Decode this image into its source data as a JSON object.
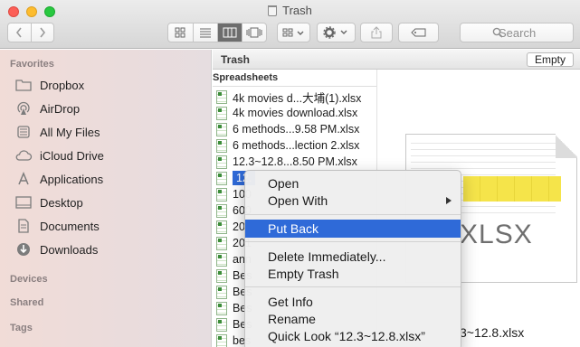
{
  "window": {
    "title": "Trash"
  },
  "toolbar": {
    "search_placeholder": "Search"
  },
  "sidebar": {
    "sections": {
      "favorites": "Favorites",
      "devices": "Devices",
      "shared": "Shared",
      "tags": "Tags"
    },
    "items": [
      {
        "label": "Dropbox",
        "icon": "folder-icon"
      },
      {
        "label": "AirDrop",
        "icon": "airdrop-icon"
      },
      {
        "label": "All My Files",
        "icon": "all-files-icon"
      },
      {
        "label": "iCloud Drive",
        "icon": "cloud-icon"
      },
      {
        "label": "Applications",
        "icon": "applications-icon"
      },
      {
        "label": "Desktop",
        "icon": "desktop-icon"
      },
      {
        "label": "Documents",
        "icon": "documents-icon"
      },
      {
        "label": "Downloads",
        "icon": "downloads-icon"
      }
    ]
  },
  "pathbar": {
    "label": "Trash",
    "empty_button": "Empty"
  },
  "filelist": {
    "column_header": "Spreadsheets",
    "files": [
      "4k movies d...大埔(1).xlsx",
      "4k movies download.xlsx",
      "6 methods...9.58 PM.xlsx",
      "6 methods...lection 2.xlsx",
      "12.3~12.8...8.50 PM.xlsx",
      "12.",
      "100",
      "600",
      "201",
      "201",
      "ann",
      "Bes",
      "Bes",
      "Bes",
      "Bes",
      "bes"
    ],
    "selected_index": 5
  },
  "preview": {
    "type_label": "XLSX",
    "filename": "3~12.8.xlsx"
  },
  "context_menu": {
    "open": "Open",
    "open_with": "Open With",
    "put_back": "Put Back",
    "delete_immediately": "Delete Immediately...",
    "empty_trash": "Empty Trash",
    "get_info": "Get Info",
    "rename": "Rename",
    "quick_look": "Quick Look “12.3~12.8.xlsx”"
  },
  "colors": {
    "selection": "#2f6ad8",
    "close": "#fc5f57",
    "minimize": "#fdbc2e",
    "maximize": "#28c840"
  }
}
